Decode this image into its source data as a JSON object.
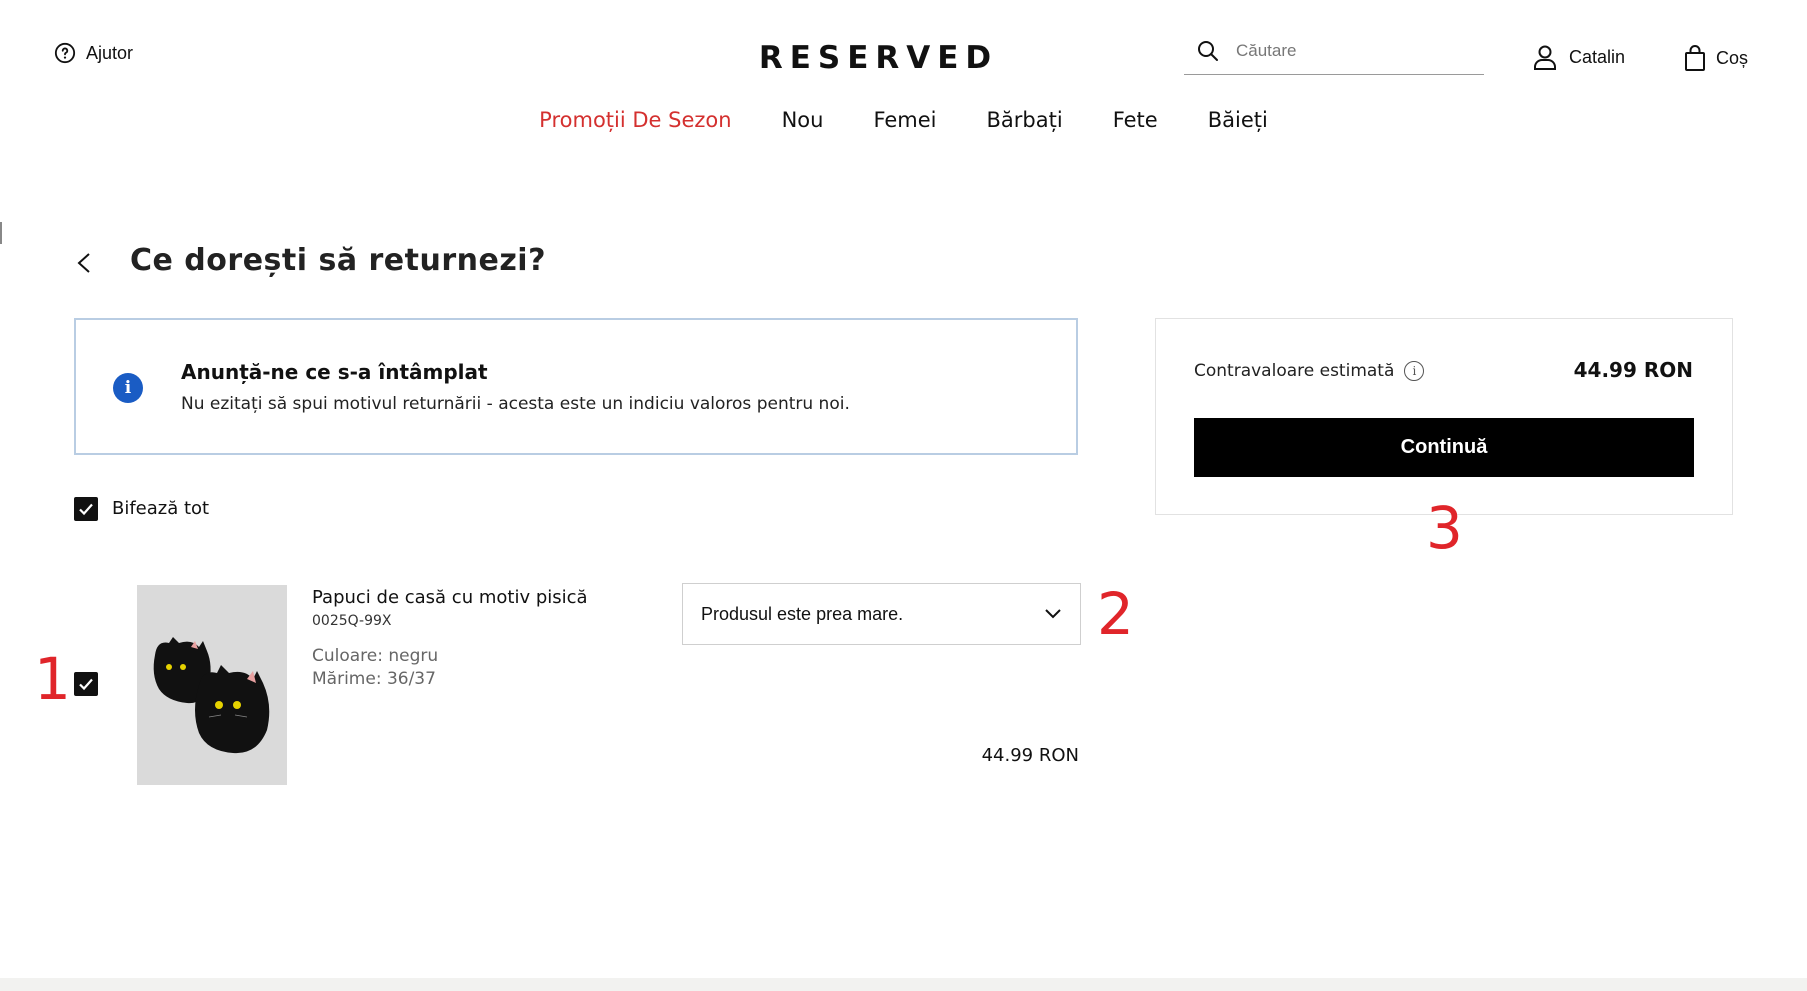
{
  "header": {
    "help_label": "Ajutor",
    "logo": "RESERVED",
    "search_placeholder": "Căutare",
    "account_label": "Catalin",
    "cart_label": "Coș"
  },
  "nav": {
    "items": [
      "Promoții De Sezon",
      "Nou",
      "Femei",
      "Bărbați",
      "Fete",
      "Băieți"
    ]
  },
  "page": {
    "title": "Ce dorești să returnezi?"
  },
  "info": {
    "icon": "i",
    "title": "Anunță-ne ce s-a întâmplat",
    "text": "Nu ezitați să spui motivul returnării - acesta este un indiciu valoros pentru noi."
  },
  "select_all": {
    "label": "Bifează tot",
    "checked": true
  },
  "product": {
    "name": "Papuci de casă cu motiv pisică",
    "code": "0025Q-99X",
    "color": "Culoare: negru",
    "size": "Mărime: 36/37",
    "reason": "Produsul este prea mare.",
    "price": "44.99 RON",
    "checked": true
  },
  "summary": {
    "label": "Contravaloare estimată",
    "info_icon": "i",
    "value": "44.99 RON",
    "button": "Continuă"
  },
  "annotations": [
    "1",
    "2",
    "3"
  ],
  "colors": {
    "promo": "#d4302f",
    "annotation": "#e0252a",
    "info_icon": "#1a5cc4",
    "info_border": "#b9cde3",
    "button_bg": "#000000"
  }
}
